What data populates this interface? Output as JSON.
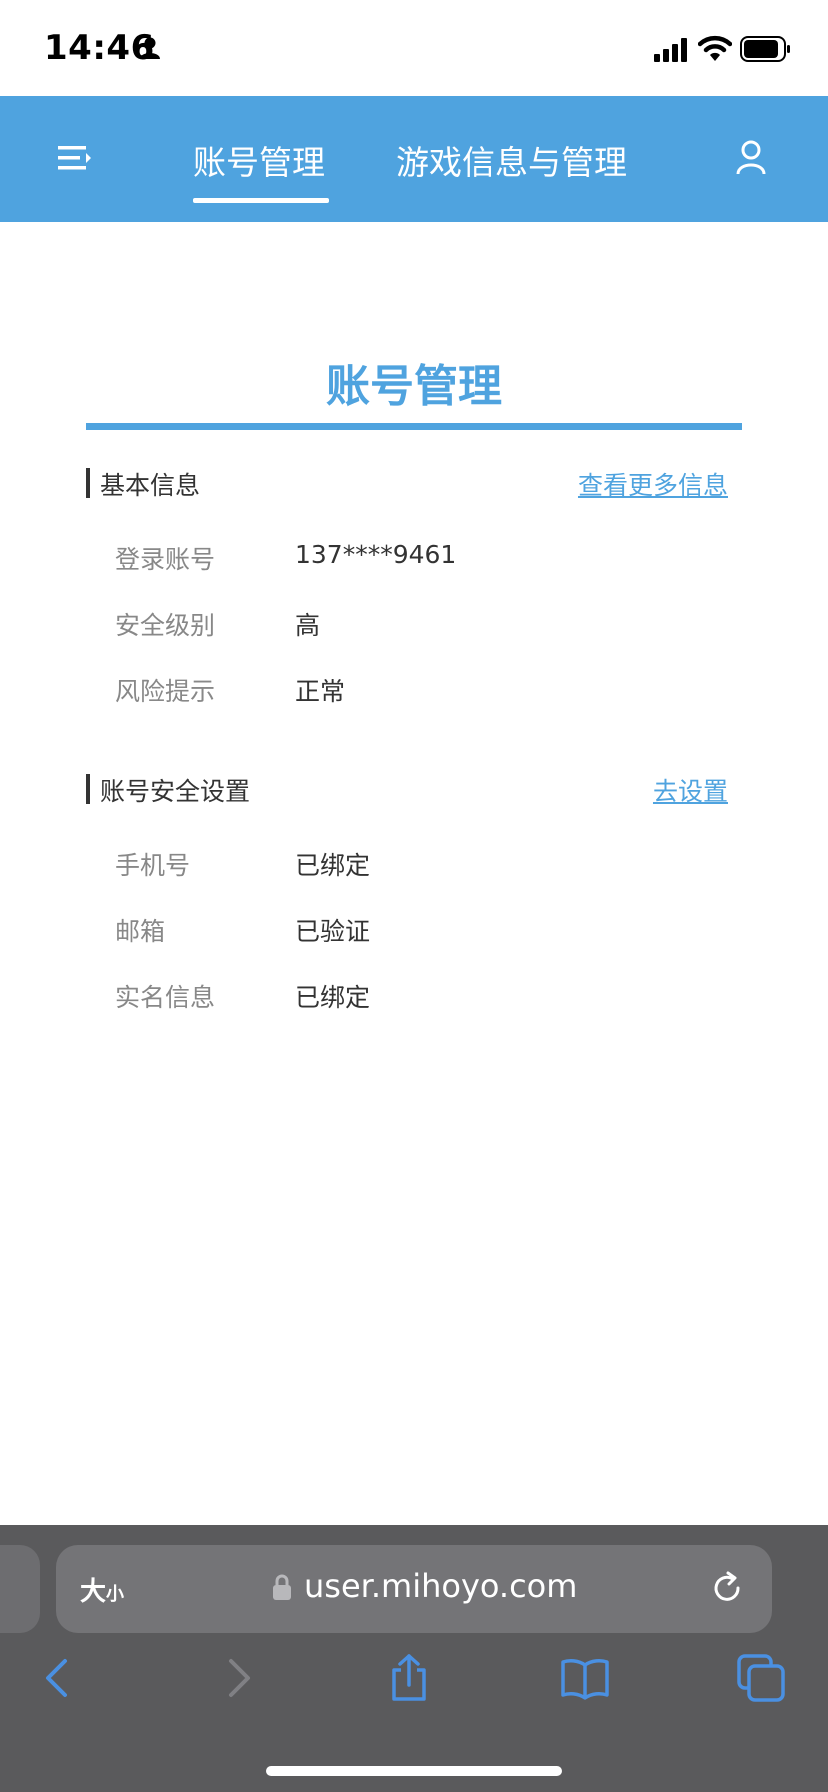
{
  "status_bar": {
    "time": "14:46"
  },
  "nav": {
    "tabs": [
      {
        "label": "账号管理",
        "active": true
      },
      {
        "label": "游戏信息与管理",
        "active": false
      }
    ]
  },
  "page": {
    "title": "账号管理"
  },
  "sections": [
    {
      "title": "基本信息",
      "link": "查看更多信息",
      "rows": [
        {
          "label": "登录账号",
          "value": "137****9461"
        },
        {
          "label": "安全级别",
          "value": "高"
        },
        {
          "label": "风险提示",
          "value": "正常"
        }
      ]
    },
    {
      "title": "账号安全设置",
      "link": "去设置",
      "rows": [
        {
          "label": "手机号",
          "value": "已绑定"
        },
        {
          "label": "邮箱",
          "value": "已验证"
        },
        {
          "label": "实名信息",
          "value": "已绑定"
        }
      ]
    }
  ],
  "browser": {
    "text_size_big": "大",
    "text_size_small": "小",
    "url": "user.mihoyo.com"
  },
  "colors": {
    "brand": "#4fa3df",
    "browser_bg": "#5a5a5c",
    "toolbar_icon": "#4a90e2"
  }
}
